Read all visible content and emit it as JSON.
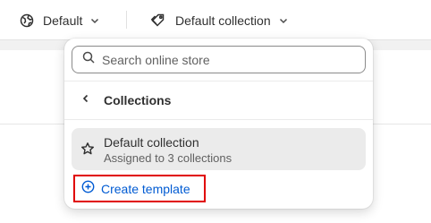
{
  "topbar": {
    "theme_picker": {
      "label": "Default",
      "icon": "globe-icon"
    },
    "template_picker": {
      "label": "Default collection",
      "icon": "tag-icon"
    }
  },
  "popover": {
    "search": {
      "placeholder": "Search online store",
      "value": ""
    },
    "section": {
      "title": "Collections",
      "back_icon": "chevron-left-icon"
    },
    "items": [
      {
        "title": "Default collection",
        "subtitle": "Assigned to 3 collections",
        "icon": "star-icon",
        "selected": true
      }
    ],
    "create_template": {
      "label": "Create template",
      "icon": "plus-circle-icon",
      "color": "#005bd3"
    }
  },
  "colors": {
    "link": "#005bd3",
    "highlight": "#e00000",
    "selected_bg": "#ebebeb"
  }
}
